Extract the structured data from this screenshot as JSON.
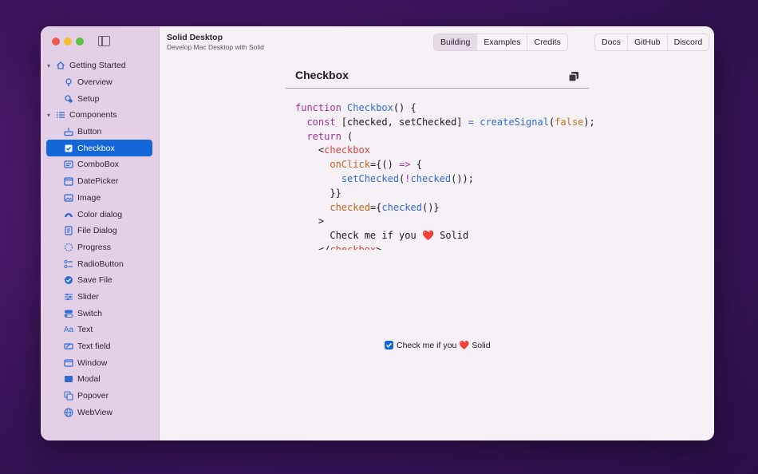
{
  "app": {
    "title": "Solid Desktop",
    "subtitle": "Develop Mac Desktop with Solid"
  },
  "header": {
    "tabs": [
      {
        "label": "Building",
        "selected": true
      },
      {
        "label": "Examples",
        "selected": false
      },
      {
        "label": "Credits",
        "selected": false
      }
    ],
    "links": [
      {
        "label": "Docs"
      },
      {
        "label": "GitHub"
      },
      {
        "label": "Discord"
      }
    ]
  },
  "sidebar": {
    "sections": [
      {
        "label": "Getting Started",
        "icon": "house-icon",
        "items": [
          {
            "label": "Overview",
            "icon": "lightbulb-icon"
          },
          {
            "label": "Setup",
            "icon": "gear-person-icon"
          }
        ]
      },
      {
        "label": "Components",
        "icon": "list-icon",
        "items": [
          {
            "label": "Button",
            "icon": "button-icon"
          },
          {
            "label": "Checkbox",
            "icon": "checkbox-icon",
            "active": true
          },
          {
            "label": "ComboBox",
            "icon": "combobox-icon"
          },
          {
            "label": "DatePicker",
            "icon": "calendar-icon"
          },
          {
            "label": "Image",
            "icon": "image-icon"
          },
          {
            "label": "Color dialog",
            "icon": "rainbow-icon"
          },
          {
            "label": "File Dialog",
            "icon": "document-icon"
          },
          {
            "label": "Progress",
            "icon": "spinner-icon"
          },
          {
            "label": "RadioButton",
            "icon": "radio-list-icon"
          },
          {
            "label": "Save File",
            "icon": "checkmark-circle-icon"
          },
          {
            "label": "Slider",
            "icon": "sliders-icon"
          },
          {
            "label": "Switch",
            "icon": "switch-icon"
          },
          {
            "label": "Text",
            "icon": "text-aa-icon"
          },
          {
            "label": "Text field",
            "icon": "text-field-icon"
          },
          {
            "label": "Window",
            "icon": "window-icon"
          },
          {
            "label": "Modal",
            "icon": "modal-icon"
          },
          {
            "label": "Popover",
            "icon": "popover-icon"
          },
          {
            "label": "WebView",
            "icon": "globe-icon"
          }
        ]
      }
    ]
  },
  "panel": {
    "title": "Checkbox",
    "code": {
      "l1_kw": "function",
      "l1_fn": "Checkbox",
      "l1_rest": "() {",
      "l2_kw": "const",
      "l2_mid": " [checked, setChecked] ",
      "l2_eq": "=",
      "l2_fn": "createSignal",
      "l2_open": "(",
      "l2_bool": "false",
      "l2_close": ");",
      "l3_kw": "return",
      "l3_rest": " (",
      "l4_lt": "<",
      "l4_tag": "checkbox",
      "l5_attr": "onClick",
      "l5_mid": "={() ",
      "l5_arrow": "=>",
      "l5_rest": " {",
      "l6_fn": "setChecked",
      "l6_mid": "(",
      "l6_bang": "!",
      "l6_fn2": "checked",
      "l6_rest": "());",
      "l7": "}}",
      "l8_attr": "checked",
      "l8_mid": "={",
      "l8_fn": "checked",
      "l8_rest": "()}",
      "l9": ">",
      "l10_a": "Check me if you ",
      "l10_heart": "❤️",
      "l10_b": " Solid",
      "l11_lt": "</",
      "l11_tag": "checkbox",
      "l11_gt": ">"
    },
    "demo": {
      "checked": true,
      "label_a": "Check me if you ",
      "heart": "❤️",
      "label_b": " Solid"
    }
  },
  "colors": {
    "accent": "#1467d9",
    "sidebar_bg": "#e4d0e6",
    "keyword": "#a42e9a",
    "function": "#2f6bd1",
    "tag": "#d2453a"
  }
}
